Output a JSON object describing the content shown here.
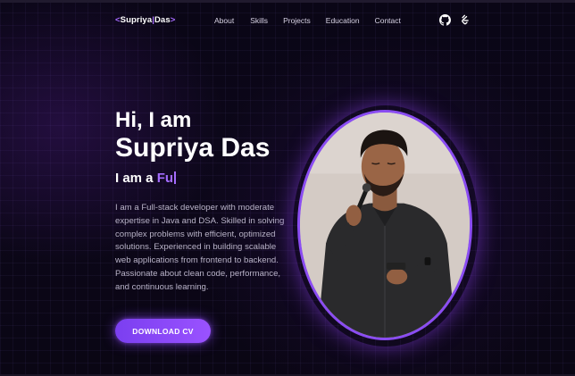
{
  "header": {
    "logo": {
      "open": "<",
      "first": "Supriya",
      "sep": "|",
      "last": "Das",
      "close": ">"
    },
    "nav": [
      {
        "label": "About"
      },
      {
        "label": "Skills"
      },
      {
        "label": "Projects"
      },
      {
        "label": "Education"
      },
      {
        "label": "Contact"
      }
    ],
    "icons": [
      "github-icon",
      "leetcode-icon"
    ]
  },
  "hero": {
    "greeting": "Hi, I am",
    "name": "Supriya Das",
    "role_prefix": "I am a ",
    "role_typed": "Fu",
    "bio": "I am a Full-stack developer with moderate expertise in Java and DSA. Skilled in solving complex problems with efficient, optimized solutions. Experienced in building scalable web applications from frontend to backend. Passionate about clean code, performance, and continuous learning.",
    "cv_button": "DOWNLOAD CV"
  },
  "colors": {
    "accent": "#a46cff",
    "button": "#8a4cf2",
    "background": "#0b0718"
  }
}
